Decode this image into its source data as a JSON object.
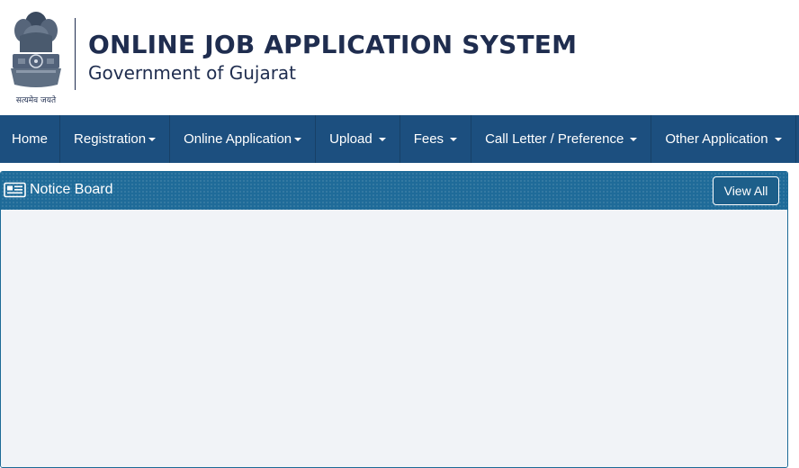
{
  "header": {
    "title": "ONLINE JOB APPLICATION SYSTEM",
    "subtitle": "Government of Gujarat",
    "emblem_motto": "सत्यमेव जयते"
  },
  "nav": {
    "items": [
      {
        "label": "Home"
      },
      {
        "label": "Registration"
      },
      {
        "label": "Online Application"
      },
      {
        "label": "Upload"
      },
      {
        "label": "Fees"
      },
      {
        "label": "Call Letter / Preference"
      },
      {
        "label": "Other Application"
      }
    ]
  },
  "notice_board": {
    "title": "Notice Board",
    "view_all_label": "View All",
    "icon": "newspaper-icon"
  },
  "colors": {
    "brand_dark": "#1f2d4f",
    "navbar": "#1c4f7f",
    "panel_header": "#1f6b99",
    "panel_body": "#f1f3f7"
  }
}
